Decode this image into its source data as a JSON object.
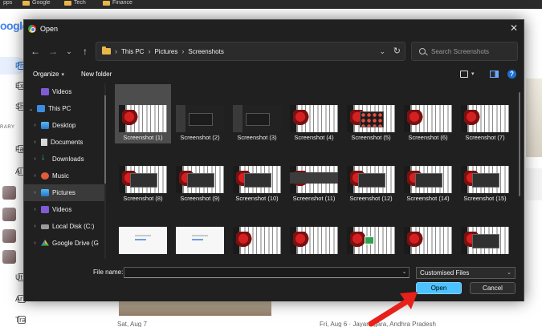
{
  "browser": {
    "bookmarks": [
      "pps",
      "Google",
      "Tech",
      "Finance"
    ],
    "google_logo": "oogle",
    "side_nav": [
      {
        "label": "Ph",
        "active": true
      },
      {
        "label": "Ex",
        "active": false
      },
      {
        "label": "Sh",
        "active": false
      }
    ],
    "section_label": "RARY",
    "side_nav2": [
      {
        "label": "Fa"
      },
      {
        "label": "Al"
      }
    ],
    "side_nav3": [
      {
        "label": "Ut"
      },
      {
        "label": "Ar"
      },
      {
        "label": "Trash"
      }
    ],
    "bottom_dates": [
      "Sat, Aug 7",
      "Fri, Aug 6 · Jayanagara, Andhra Pradesh"
    ]
  },
  "dialog": {
    "title": "Open",
    "close_glyph": "✕",
    "nav": {
      "back": "←",
      "forward": "→",
      "recent": "⌄",
      "up": "↑"
    },
    "breadcrumb": [
      "This PC",
      "Pictures",
      "Screenshots"
    ],
    "breadcrumb_sep": "›",
    "address_dropdown": "⌄",
    "refresh": "↻",
    "search_placeholder": "Search Screenshots",
    "toolbar": {
      "organize_label": "Organize",
      "organize_arrow": "▾",
      "new_folder_label": "New folder",
      "view_arrow": "▾",
      "help": "?"
    },
    "nav_pane": [
      {
        "label": "Videos",
        "icon": "video",
        "indent": 1,
        "chevron": ""
      },
      {
        "label": "This PC",
        "icon": "pc",
        "indent": 0,
        "chevron": "⌄"
      },
      {
        "label": "Desktop",
        "icon": "desk",
        "indent": 1,
        "chevron": "›"
      },
      {
        "label": "Documents",
        "icon": "docs",
        "indent": 1,
        "chevron": "›"
      },
      {
        "label": "Downloads",
        "icon": "down",
        "indent": 1,
        "chevron": "›"
      },
      {
        "label": "Music",
        "icon": "music",
        "indent": 1,
        "chevron": "›"
      },
      {
        "label": "Pictures",
        "icon": "pics",
        "indent": 1,
        "chevron": "›",
        "selected": true
      },
      {
        "label": "Videos",
        "icon": "video",
        "indent": 1,
        "chevron": "›"
      },
      {
        "label": "Local Disk (C:)",
        "icon": "disk",
        "indent": 1,
        "chevron": "›"
      },
      {
        "label": "Google Drive (G",
        "icon": "gdrive",
        "indent": 1,
        "chevron": "›"
      }
    ],
    "files": [
      {
        "name": "Screenshot (1)",
        "style": "",
        "selected": true
      },
      {
        "name": "Screenshot (2)",
        "style": "dark"
      },
      {
        "name": "Screenshot (3)",
        "style": "dark"
      },
      {
        "name": "Screenshot (4)",
        "style": ""
      },
      {
        "name": "Screenshot (5)",
        "style": "apps"
      },
      {
        "name": "Screenshot (6)",
        "style": ""
      },
      {
        "name": "Screenshot (7)",
        "style": ""
      },
      {
        "name": "Screenshot (8)",
        "style": "dlg"
      },
      {
        "name": "Screenshot (9)",
        "style": "dlg"
      },
      {
        "name": "Screenshot (10)",
        "style": "dlg"
      },
      {
        "name": "Screenshot (11)",
        "style": "bar"
      },
      {
        "name": "Screenshot (12)",
        "style": "dlg"
      },
      {
        "name": "Screenshot (14)",
        "style": "dlg"
      },
      {
        "name": "Screenshot (15)",
        "style": "dlg"
      },
      {
        "name": "",
        "style": "white"
      },
      {
        "name": "",
        "style": "white"
      },
      {
        "name": "",
        "style": ""
      },
      {
        "name": "",
        "style": ""
      },
      {
        "name": "",
        "style": "green"
      },
      {
        "name": "",
        "style": ""
      },
      {
        "name": "",
        "style": "dlg"
      }
    ],
    "footer": {
      "file_name_label": "File name:",
      "file_name_value": "",
      "file_type": "Customised Files",
      "dd_glyph": "⌄",
      "open_label": "Open",
      "cancel_label": "Cancel"
    }
  },
  "annotation": {
    "arrow_color": "#e8201a"
  }
}
